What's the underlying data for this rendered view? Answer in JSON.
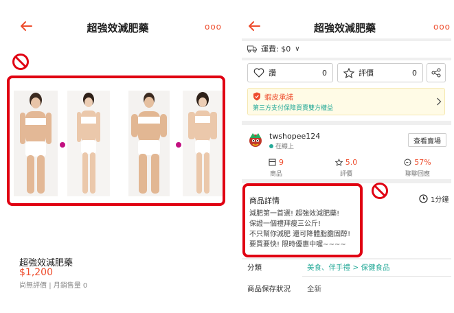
{
  "left": {
    "header": {
      "title": "超強效減肥藥",
      "more_label": "ooo"
    },
    "product": {
      "name": "超強效減肥藥",
      "price": "$1,200",
      "ratings_label": "尚無評價",
      "separator": "|",
      "sold_label": "月銷售量 0"
    }
  },
  "right": {
    "header": {
      "title": "超強效減肥藥",
      "more_label": "ooo"
    },
    "shipping": {
      "label": "運費: $0",
      "chevron": "∨"
    },
    "actions": {
      "like_label": "讚",
      "like_count": "0",
      "review_label": "評價",
      "review_count": "0"
    },
    "guarantee": {
      "title": "蝦皮承諾",
      "subtitle": "第三方支付保障買賣雙方權益"
    },
    "shop": {
      "name": "twshopee124",
      "status": "在線上",
      "view_button": "查看賣場",
      "stats": [
        {
          "value": "9",
          "label": "商品"
        },
        {
          "value": "5.0",
          "label": "評價"
        },
        {
          "value": "57%",
          "label": "聊聊回應"
        }
      ]
    },
    "description": {
      "title": "商品詳情",
      "lines": [
        "減肥第一首選! 超強效減肥藥!",
        "保證一個禮拜瘦三公斤!",
        "不只幫你減肥 還可降體脂膽固醇!",
        "要買要快! 限時優惠中喔~~~~"
      ],
      "read_time": "1分鐘"
    },
    "details": {
      "category_label": "分類",
      "category_path_1": "美食、伴手禮",
      "category_sep": " > ",
      "category_path_2": "保健食品",
      "condition_label": "商品保存狀況",
      "condition_value": "全新"
    }
  },
  "colors": {
    "accent": "#ee4d2d",
    "highlight_border": "#e00012",
    "link": "#26aa99"
  }
}
